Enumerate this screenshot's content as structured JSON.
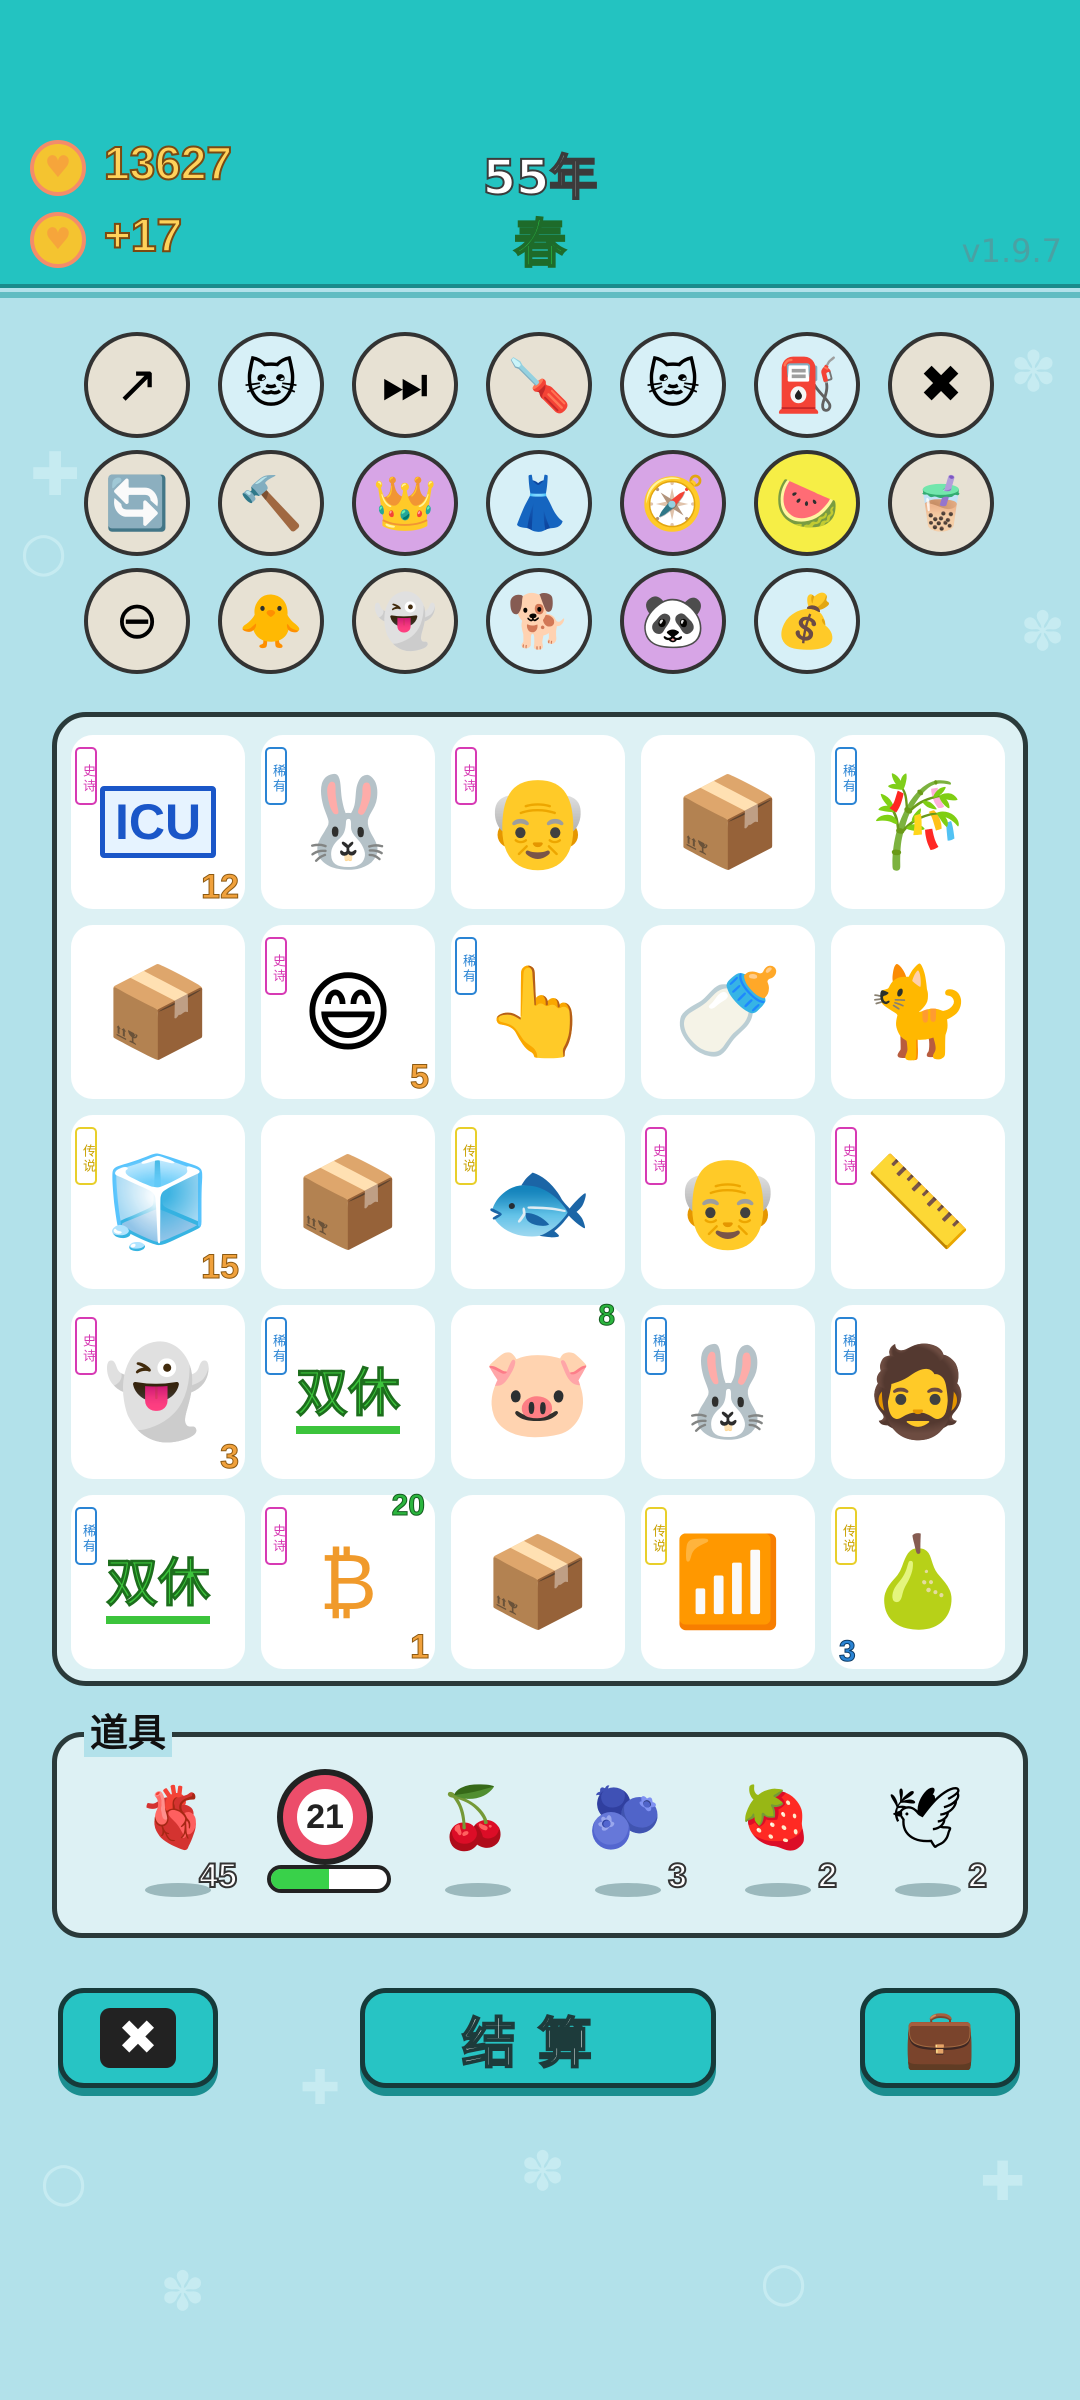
{
  "header": {
    "coins": "13627",
    "income": "+17",
    "year": "55年",
    "season": "春",
    "version": "v1.9.7"
  },
  "trinkets": [
    {
      "name": "arrow-card-icon",
      "glyph": "↗",
      "bg": "#e7e1d3"
    },
    {
      "name": "cat-cup-icon",
      "glyph": "🐱",
      "bg": "#d7f0f7"
    },
    {
      "name": "skip-icon",
      "glyph": "⏭",
      "bg": "#e7e1d3"
    },
    {
      "name": "screwdriver-icon",
      "glyph": "🪛",
      "bg": "#e7e1d3"
    },
    {
      "name": "cat-cup-icon",
      "glyph": "🐱",
      "bg": "#d7f0f7"
    },
    {
      "name": "air-pump-icon",
      "glyph": "⛽",
      "bg": "#d7f0f7"
    },
    {
      "name": "remove-tag-icon",
      "glyph": "✖",
      "bg": "#e7e1d3"
    },
    {
      "name": "refresh-icon",
      "glyph": "🔄",
      "bg": "#e7e1d3"
    },
    {
      "name": "hammer-icon",
      "glyph": "🔨",
      "bg": "#e7e1d3"
    },
    {
      "name": "crown-card-icon",
      "glyph": "👑",
      "bg": "#d7a5e6"
    },
    {
      "name": "skirt-icon",
      "glyph": "👗",
      "bg": "#d7f0f7"
    },
    {
      "name": "compass-icon",
      "glyph": "🧭",
      "bg": "#d7a5e6"
    },
    {
      "name": "fruit-basket-icon",
      "glyph": "🍉",
      "bg": "#f6ee46"
    },
    {
      "name": "bubble-tea-icon",
      "glyph": "🧋",
      "bg": "#e7e1d3"
    },
    {
      "name": "minus-icon",
      "glyph": "⊖",
      "bg": "#e7e1d3"
    },
    {
      "name": "chick-icon",
      "glyph": "🐥",
      "bg": "#e7e1d3"
    },
    {
      "name": "ghost-icon",
      "glyph": "👻",
      "bg": "#e7e1d3"
    },
    {
      "name": "cool-dog-icon",
      "glyph": "🐕",
      "bg": "#d7f0f7"
    },
    {
      "name": "panda-icon",
      "glyph": "🐼",
      "bg": "#d7a5e6"
    },
    {
      "name": "sack-icon",
      "glyph": "💰",
      "bg": "#d7f0f7"
    }
  ],
  "tiles": [
    {
      "name": "icu-sign",
      "rarity": "史诗",
      "rclass": "r-epic",
      "glyph": "ICU",
      "count": "12"
    },
    {
      "name": "rabbit",
      "rarity": "稀有",
      "rclass": "r-rare",
      "glyph": "🐰",
      "count": ""
    },
    {
      "name": "farmer",
      "rarity": "史诗",
      "rclass": "r-epic",
      "glyph": "👴",
      "count": ""
    },
    {
      "name": "parcel",
      "rarity": "",
      "rclass": "",
      "glyph": "📦",
      "count": ""
    },
    {
      "name": "bamboo",
      "rarity": "稀有",
      "rclass": "r-rare",
      "glyph": "🎋",
      "count": ""
    },
    {
      "name": "parcel",
      "rarity": "",
      "rclass": "",
      "glyph": "📦",
      "count": ""
    },
    {
      "name": "lucky-smiley",
      "rarity": "史诗",
      "rclass": "r-epic",
      "glyph": "😄",
      "count": "5"
    },
    {
      "name": "pointing-hand",
      "rarity": "稀有",
      "rclass": "r-rare",
      "glyph": "👆",
      "count": ""
    },
    {
      "name": "milk-bottle",
      "rarity": "",
      "rclass": "",
      "glyph": "🍼",
      "count": ""
    },
    {
      "name": "cat",
      "rarity": "",
      "rclass": "",
      "glyph": "🐈",
      "count": ""
    },
    {
      "name": "fridge",
      "rarity": "传说",
      "rclass": "r-legend",
      "glyph": "🧊",
      "count": "15"
    },
    {
      "name": "parcel",
      "rarity": "",
      "rclass": "",
      "glyph": "📦",
      "count": ""
    },
    {
      "name": "koi-fish",
      "rarity": "传说",
      "rclass": "r-legend",
      "glyph": "🐟",
      "count": ""
    },
    {
      "name": "farmer",
      "rarity": "史诗",
      "rclass": "r-epic",
      "glyph": "👴",
      "count": ""
    },
    {
      "name": "ruler",
      "rarity": "史诗",
      "rclass": "r-epic",
      "glyph": "📏",
      "count": ""
    },
    {
      "name": "dead-ghost",
      "rarity": "史诗",
      "rclass": "r-epic",
      "glyph": "👻",
      "count": "3"
    },
    {
      "name": "weekend-text",
      "rarity": "稀有",
      "rclass": "r-rare",
      "glyph": "双休",
      "count": ""
    },
    {
      "name": "pig",
      "rarity": "",
      "rclass": "",
      "glyph": "🐷",
      "count": "",
      "top": "8"
    },
    {
      "name": "sleeping-rabbit",
      "rarity": "稀有",
      "rclass": "r-rare",
      "glyph": "🐰",
      "count": ""
    },
    {
      "name": "bucket-hat-man",
      "rarity": "稀有",
      "rclass": "r-rare",
      "glyph": "🧔",
      "count": ""
    },
    {
      "name": "weekend-text",
      "rarity": "稀有",
      "rclass": "r-rare",
      "glyph": "双休",
      "count": ""
    },
    {
      "name": "bitcoin-cycle",
      "rarity": "史诗",
      "rclass": "r-epic",
      "glyph": "₿",
      "count": "1",
      "top": "20"
    },
    {
      "name": "parcel",
      "rarity": "",
      "rclass": "",
      "glyph": "📦",
      "count": ""
    },
    {
      "name": "wifi",
      "rarity": "传说",
      "rclass": "r-legend",
      "glyph": "📶",
      "count": ""
    },
    {
      "name": "pomelo",
      "rarity": "传说",
      "rclass": "r-legend",
      "glyph": "🍐",
      "count": "",
      "left": "3"
    }
  ],
  "items_panel": {
    "title": "道具",
    "items": [
      {
        "name": "liver-item",
        "glyph": "🫀",
        "count": "45"
      },
      {
        "name": "target-item",
        "glyph": "🎯",
        "count": "21",
        "progress": 0.5
      },
      {
        "name": "lychee-item",
        "glyph": "🍒",
        "count": ""
      },
      {
        "name": "blueberry-item",
        "glyph": "🫐",
        "count": "3"
      },
      {
        "name": "strawberry-item",
        "glyph": "🍓",
        "count": "2"
      },
      {
        "name": "dove-item",
        "glyph": "🕊",
        "count": "2"
      }
    ]
  },
  "buttons": {
    "cancel_glyph": "✖",
    "settle_label": "结算",
    "bag_glyph": "💼"
  },
  "colors": {
    "topbar": "#23c3c1",
    "background": "#b2e1ea",
    "button": "#27c4c4"
  }
}
